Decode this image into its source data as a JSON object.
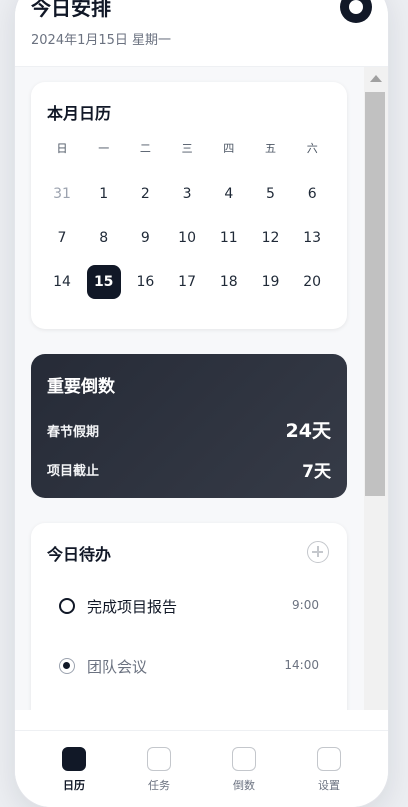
{
  "header": {
    "title": "今日安排",
    "date": "2024年1月15日 星期一"
  },
  "calendar": {
    "title": "本月日历",
    "weekdays": [
      "日",
      "一",
      "二",
      "三",
      "四",
      "五",
      "六"
    ],
    "days": [
      {
        "label": "31",
        "muted": true
      },
      {
        "label": "1"
      },
      {
        "label": "2"
      },
      {
        "label": "3"
      },
      {
        "label": "4"
      },
      {
        "label": "5"
      },
      {
        "label": "6"
      },
      {
        "label": "7"
      },
      {
        "label": "8"
      },
      {
        "label": "9"
      },
      {
        "label": "10"
      },
      {
        "label": "11"
      },
      {
        "label": "12"
      },
      {
        "label": "13"
      },
      {
        "label": "14"
      },
      {
        "label": "15",
        "today": true
      },
      {
        "label": "16"
      },
      {
        "label": "17"
      },
      {
        "label": "18"
      },
      {
        "label": "19"
      },
      {
        "label": "20"
      }
    ]
  },
  "countdown": {
    "title": "重要倒数",
    "items": [
      {
        "name": "春节假期",
        "value": "24天"
      },
      {
        "name": "项目截止",
        "value": "7天"
      }
    ]
  },
  "todo": {
    "title": "今日待办",
    "items": [
      {
        "text": "完成项目报告",
        "time": "9:00",
        "done": false
      },
      {
        "text": "团队会议",
        "time": "14:00",
        "done": true
      }
    ]
  },
  "tabbar": {
    "tabs": [
      {
        "label": "日历",
        "active": true
      },
      {
        "label": "任务"
      },
      {
        "label": "倒数"
      },
      {
        "label": "设置"
      }
    ]
  },
  "colors": {
    "primary": "#111827",
    "countdown_bg": "#2d323e",
    "muted_text": "#6b7280"
  }
}
